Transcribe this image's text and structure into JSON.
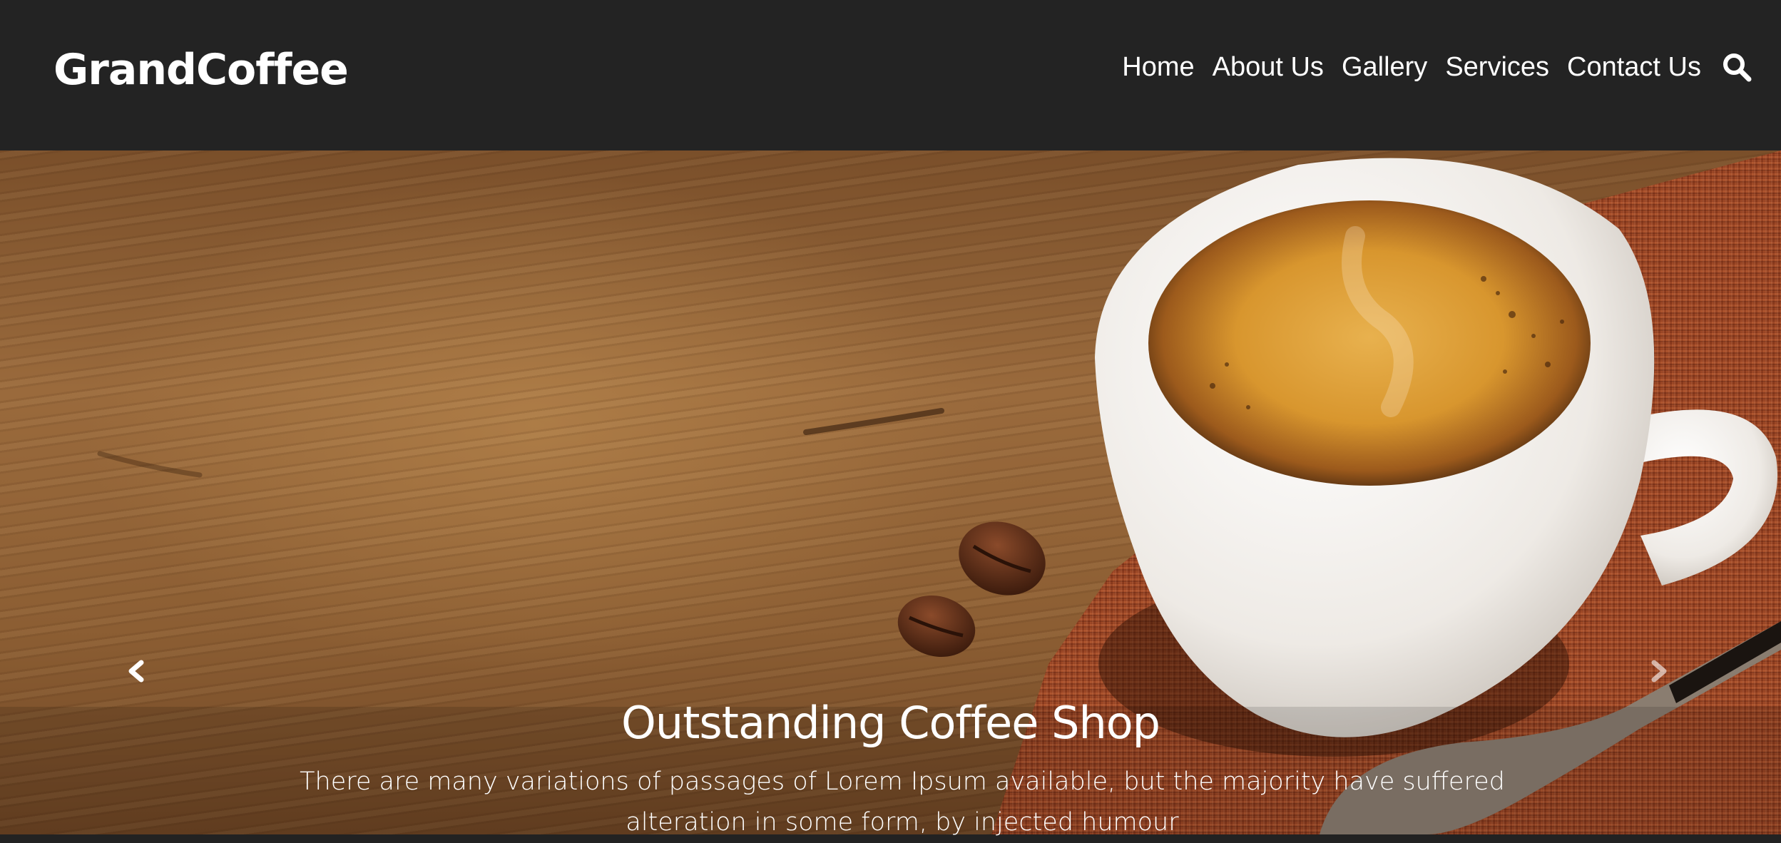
{
  "brand": {
    "name": "GrandCoffee"
  },
  "nav": {
    "items": [
      {
        "label": "Home"
      },
      {
        "label": "About Us"
      },
      {
        "label": "Gallery"
      },
      {
        "label": "Services"
      },
      {
        "label": "Contact Us"
      }
    ],
    "search_icon": "search-icon"
  },
  "hero": {
    "title": "Outstanding Coffee Shop",
    "text": "There are many variations of passages of Lorem Ipsum available, but the majority have suffered alteration in some form, by injected humour",
    "prev_icon": "chevron-left-icon",
    "next_icon": "chevron-right-icon"
  },
  "colors": {
    "header_bg": "#232323",
    "text": "#ffffff",
    "wood": "#9a6a3c",
    "cloth": "#a8502c",
    "cup": "#f1eeea",
    "crema": "#d8962e"
  }
}
